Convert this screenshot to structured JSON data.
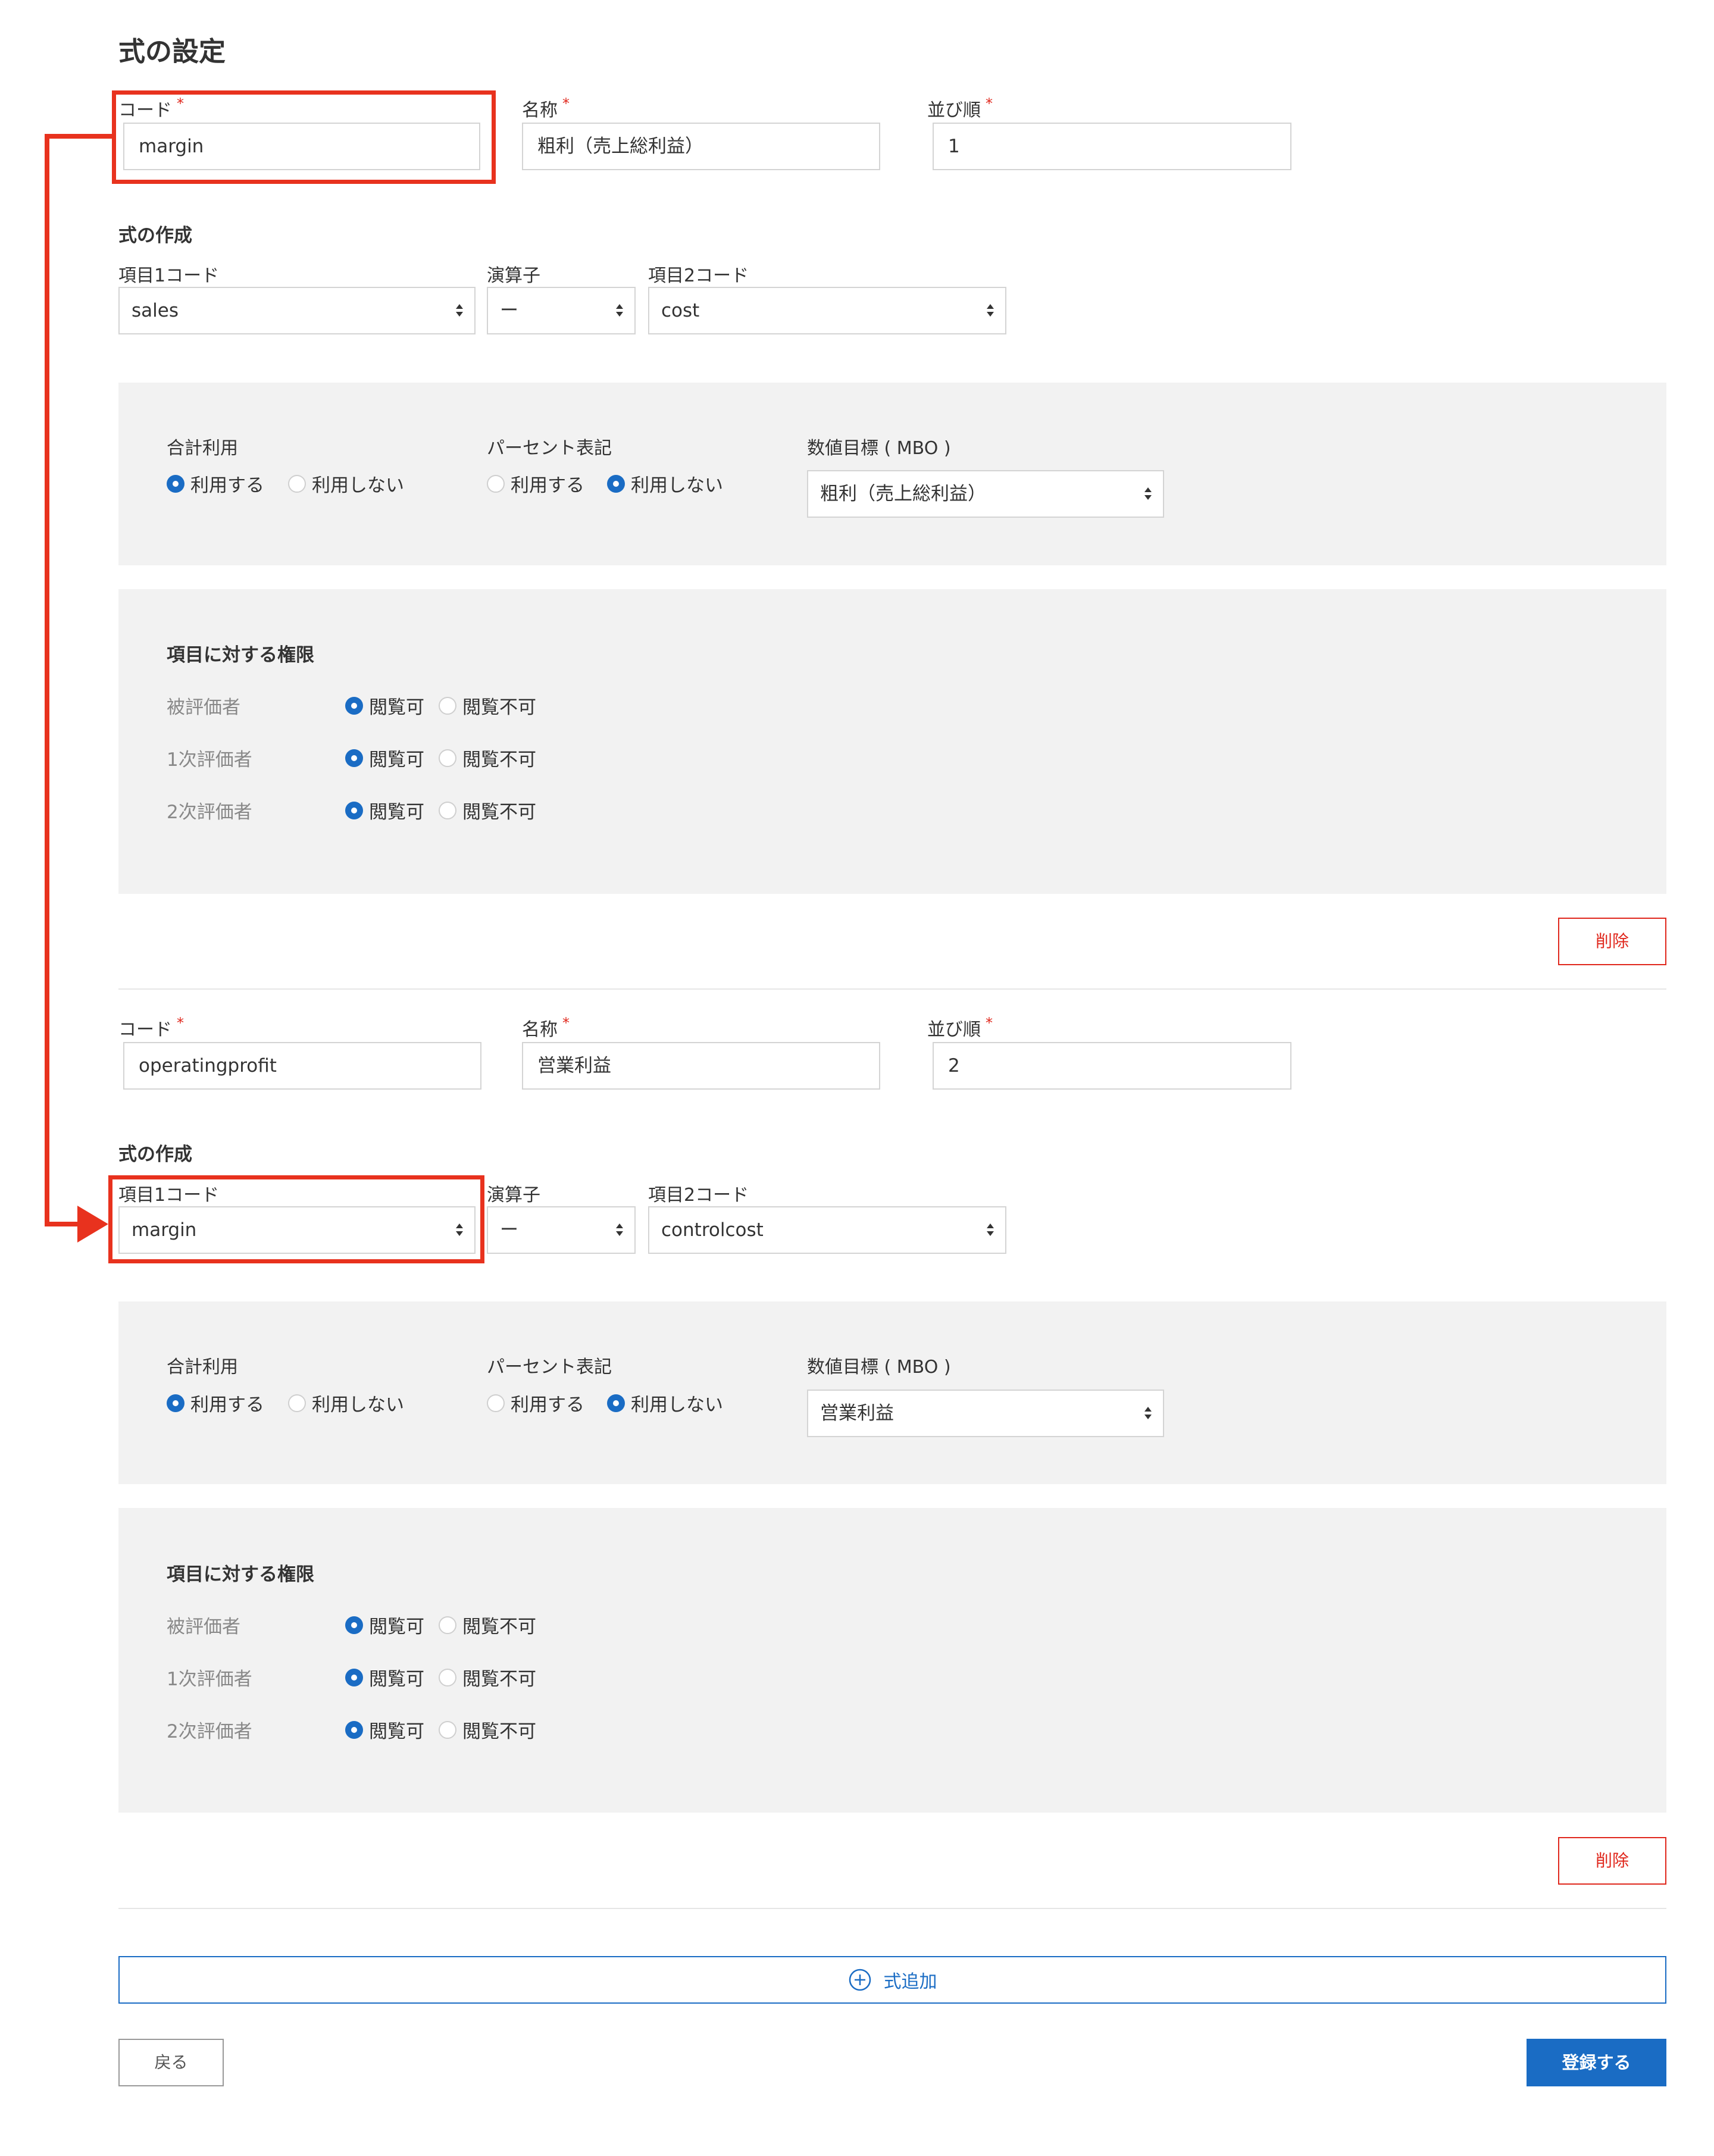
{
  "page": {
    "title": "式の設定"
  },
  "labels": {
    "code": "コード",
    "name": "名称",
    "order": "並び順",
    "required_mark": "*",
    "formula_section": "式の作成",
    "item1_code": "項目1コード",
    "operator": "演算子",
    "item2_code": "項目2コード",
    "total_use": "合計利用",
    "percent_display": "パーセント表記",
    "numeric_target": "数値目標 ( MBO )",
    "use": "利用する",
    "not_use": "利用しない",
    "permissions_section": "項目に対する権限",
    "viewable": "閲覧可",
    "not_viewable": "閲覧不可"
  },
  "roles": [
    "被評価者",
    "1次評価者",
    "2次評価者"
  ],
  "formulas": [
    {
      "code": "margin",
      "name": "粗利（売上総利益）",
      "order": "1",
      "item1": "sales",
      "operator": "ー",
      "item2": "cost",
      "total_use": "use",
      "percent_display": "not_use",
      "mbo": "粗利（売上総利益）",
      "permissions": [
        "viewable",
        "viewable",
        "viewable"
      ],
      "delete_label": "削除"
    },
    {
      "code": "operatingprofit",
      "name": "営業利益",
      "order": "2",
      "item1": "margin",
      "operator": "ー",
      "item2": "controlcost",
      "total_use": "use",
      "percent_display": "not_use",
      "mbo": "営業利益",
      "permissions": [
        "viewable",
        "viewable",
        "viewable"
      ],
      "delete_label": "削除"
    }
  ],
  "actions": {
    "add_formula": "式追加",
    "back": "戻る",
    "submit": "登録する"
  },
  "colors": {
    "primary": "#1a6cc4",
    "danger": "#e0281d",
    "highlight": "#e8321e",
    "panel": "#f2f2f2"
  }
}
